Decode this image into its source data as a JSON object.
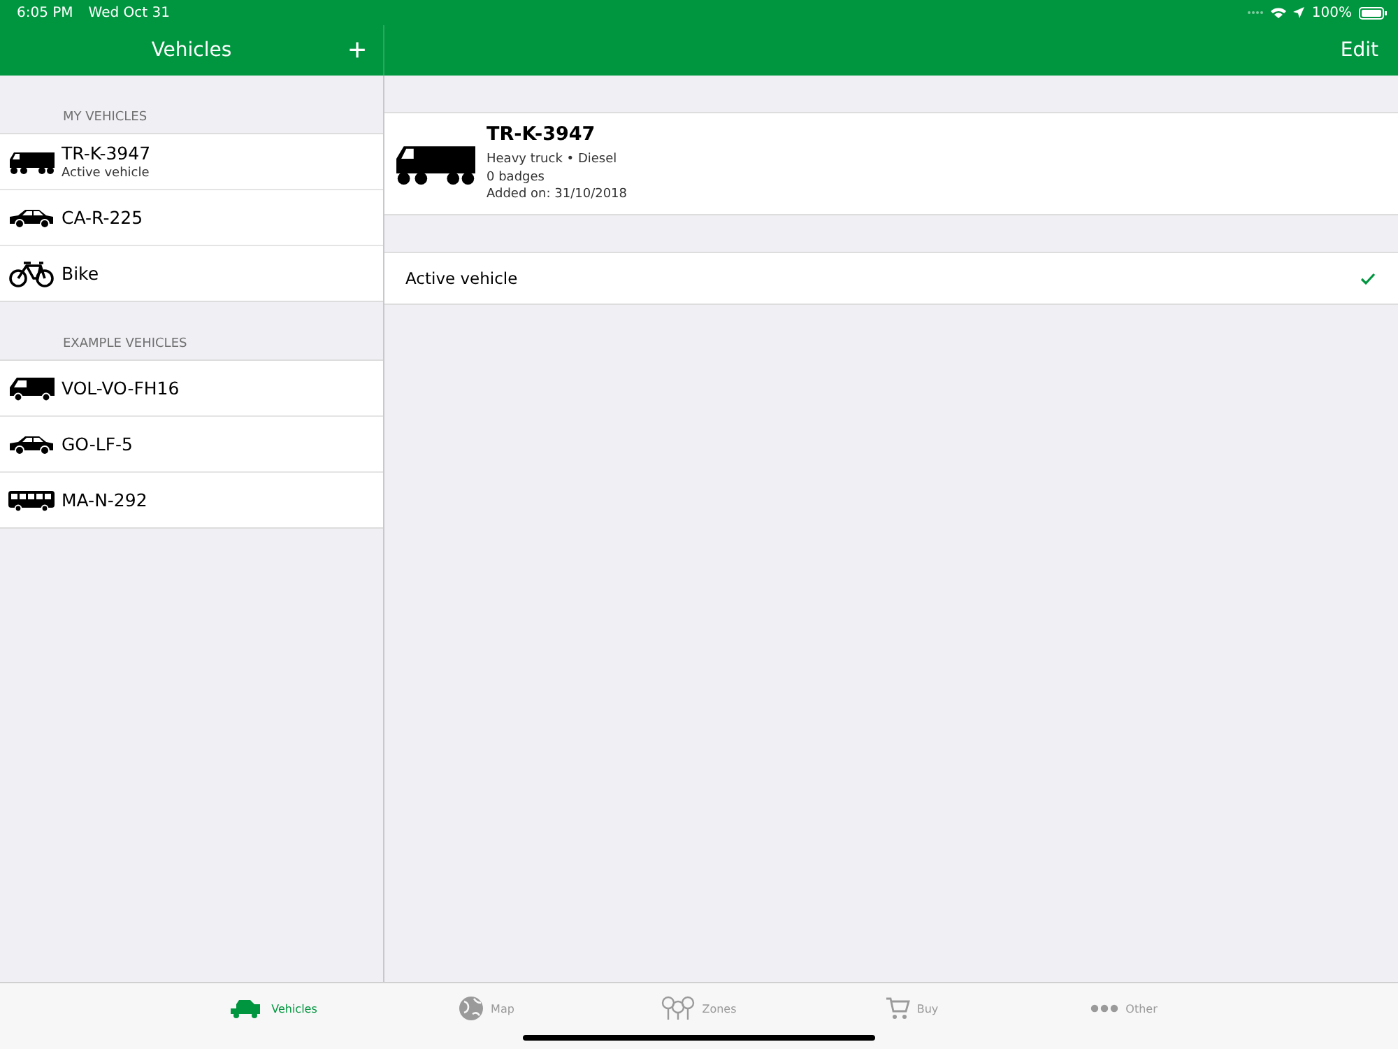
{
  "status_bar": {
    "time": "6:05 PM",
    "date": "Wed Oct 31",
    "battery": "100%"
  },
  "sidebar": {
    "title": "Vehicles",
    "add_button": "+",
    "sections": [
      {
        "header": "MY VEHICLES",
        "items": [
          {
            "kind": "truck",
            "name": "TR-K-3947",
            "subtitle": "Active vehicle"
          },
          {
            "kind": "car",
            "name": "CA-R-225"
          },
          {
            "kind": "bike",
            "name": "Bike"
          }
        ]
      },
      {
        "header": "EXAMPLE VEHICLES",
        "items": [
          {
            "kind": "van",
            "name": "VOL-VO-FH16"
          },
          {
            "kind": "car",
            "name": "GO-LF-5"
          },
          {
            "kind": "bus",
            "name": "MA-N-292"
          }
        ]
      }
    ]
  },
  "detail": {
    "edit_button": "Edit",
    "vehicle": {
      "kind": "truck",
      "name": "TR-K-3947",
      "lines": [
        "Heavy truck • Diesel",
        "0 badges",
        "Added on: 31/10/2018"
      ]
    },
    "active_row": {
      "label": "Active vehicle",
      "checked": true
    }
  },
  "tabs": [
    {
      "kind": "vehicles",
      "label": "Vehicles",
      "selected": true
    },
    {
      "kind": "map",
      "label": "Map",
      "selected": false
    },
    {
      "kind": "zones",
      "label": "Zones",
      "selected": false
    },
    {
      "kind": "buy",
      "label": "Buy",
      "selected": false
    },
    {
      "kind": "other",
      "label": "Other",
      "selected": false
    }
  ]
}
